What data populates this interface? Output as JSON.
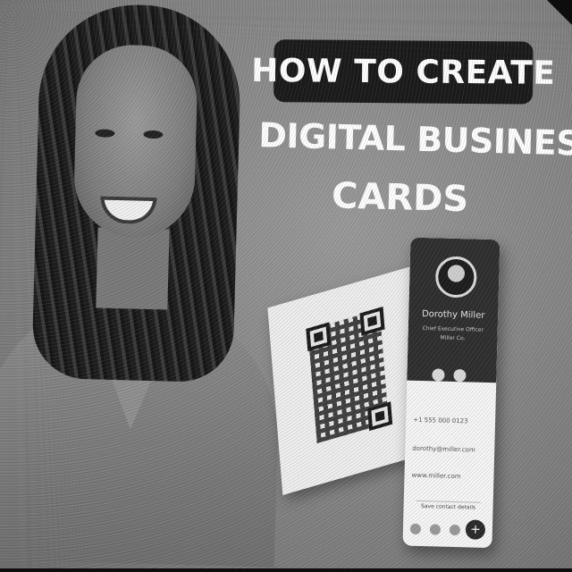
{
  "headline": {
    "line1": "HOW TO CREATE",
    "line2": "DIGITAL BUSINESS",
    "line3": "CARDS"
  },
  "phone_card": {
    "name": "Dorothy Miller",
    "title": "Chief Executive Officer",
    "company": "Miller Co.",
    "phone": "+1 555 000 0123",
    "email": "dorothy@miller.com",
    "website": "www.miller.com",
    "save_label": "Save contact details",
    "add_icon": "+"
  },
  "colors": {
    "pill_bg": "#1b1b1b",
    "headline_text": "#ffffff",
    "phone_header": "#2f2f2f"
  },
  "icons": [
    "qr-code-icon",
    "social-icon",
    "add-icon",
    "contact-icon"
  ]
}
